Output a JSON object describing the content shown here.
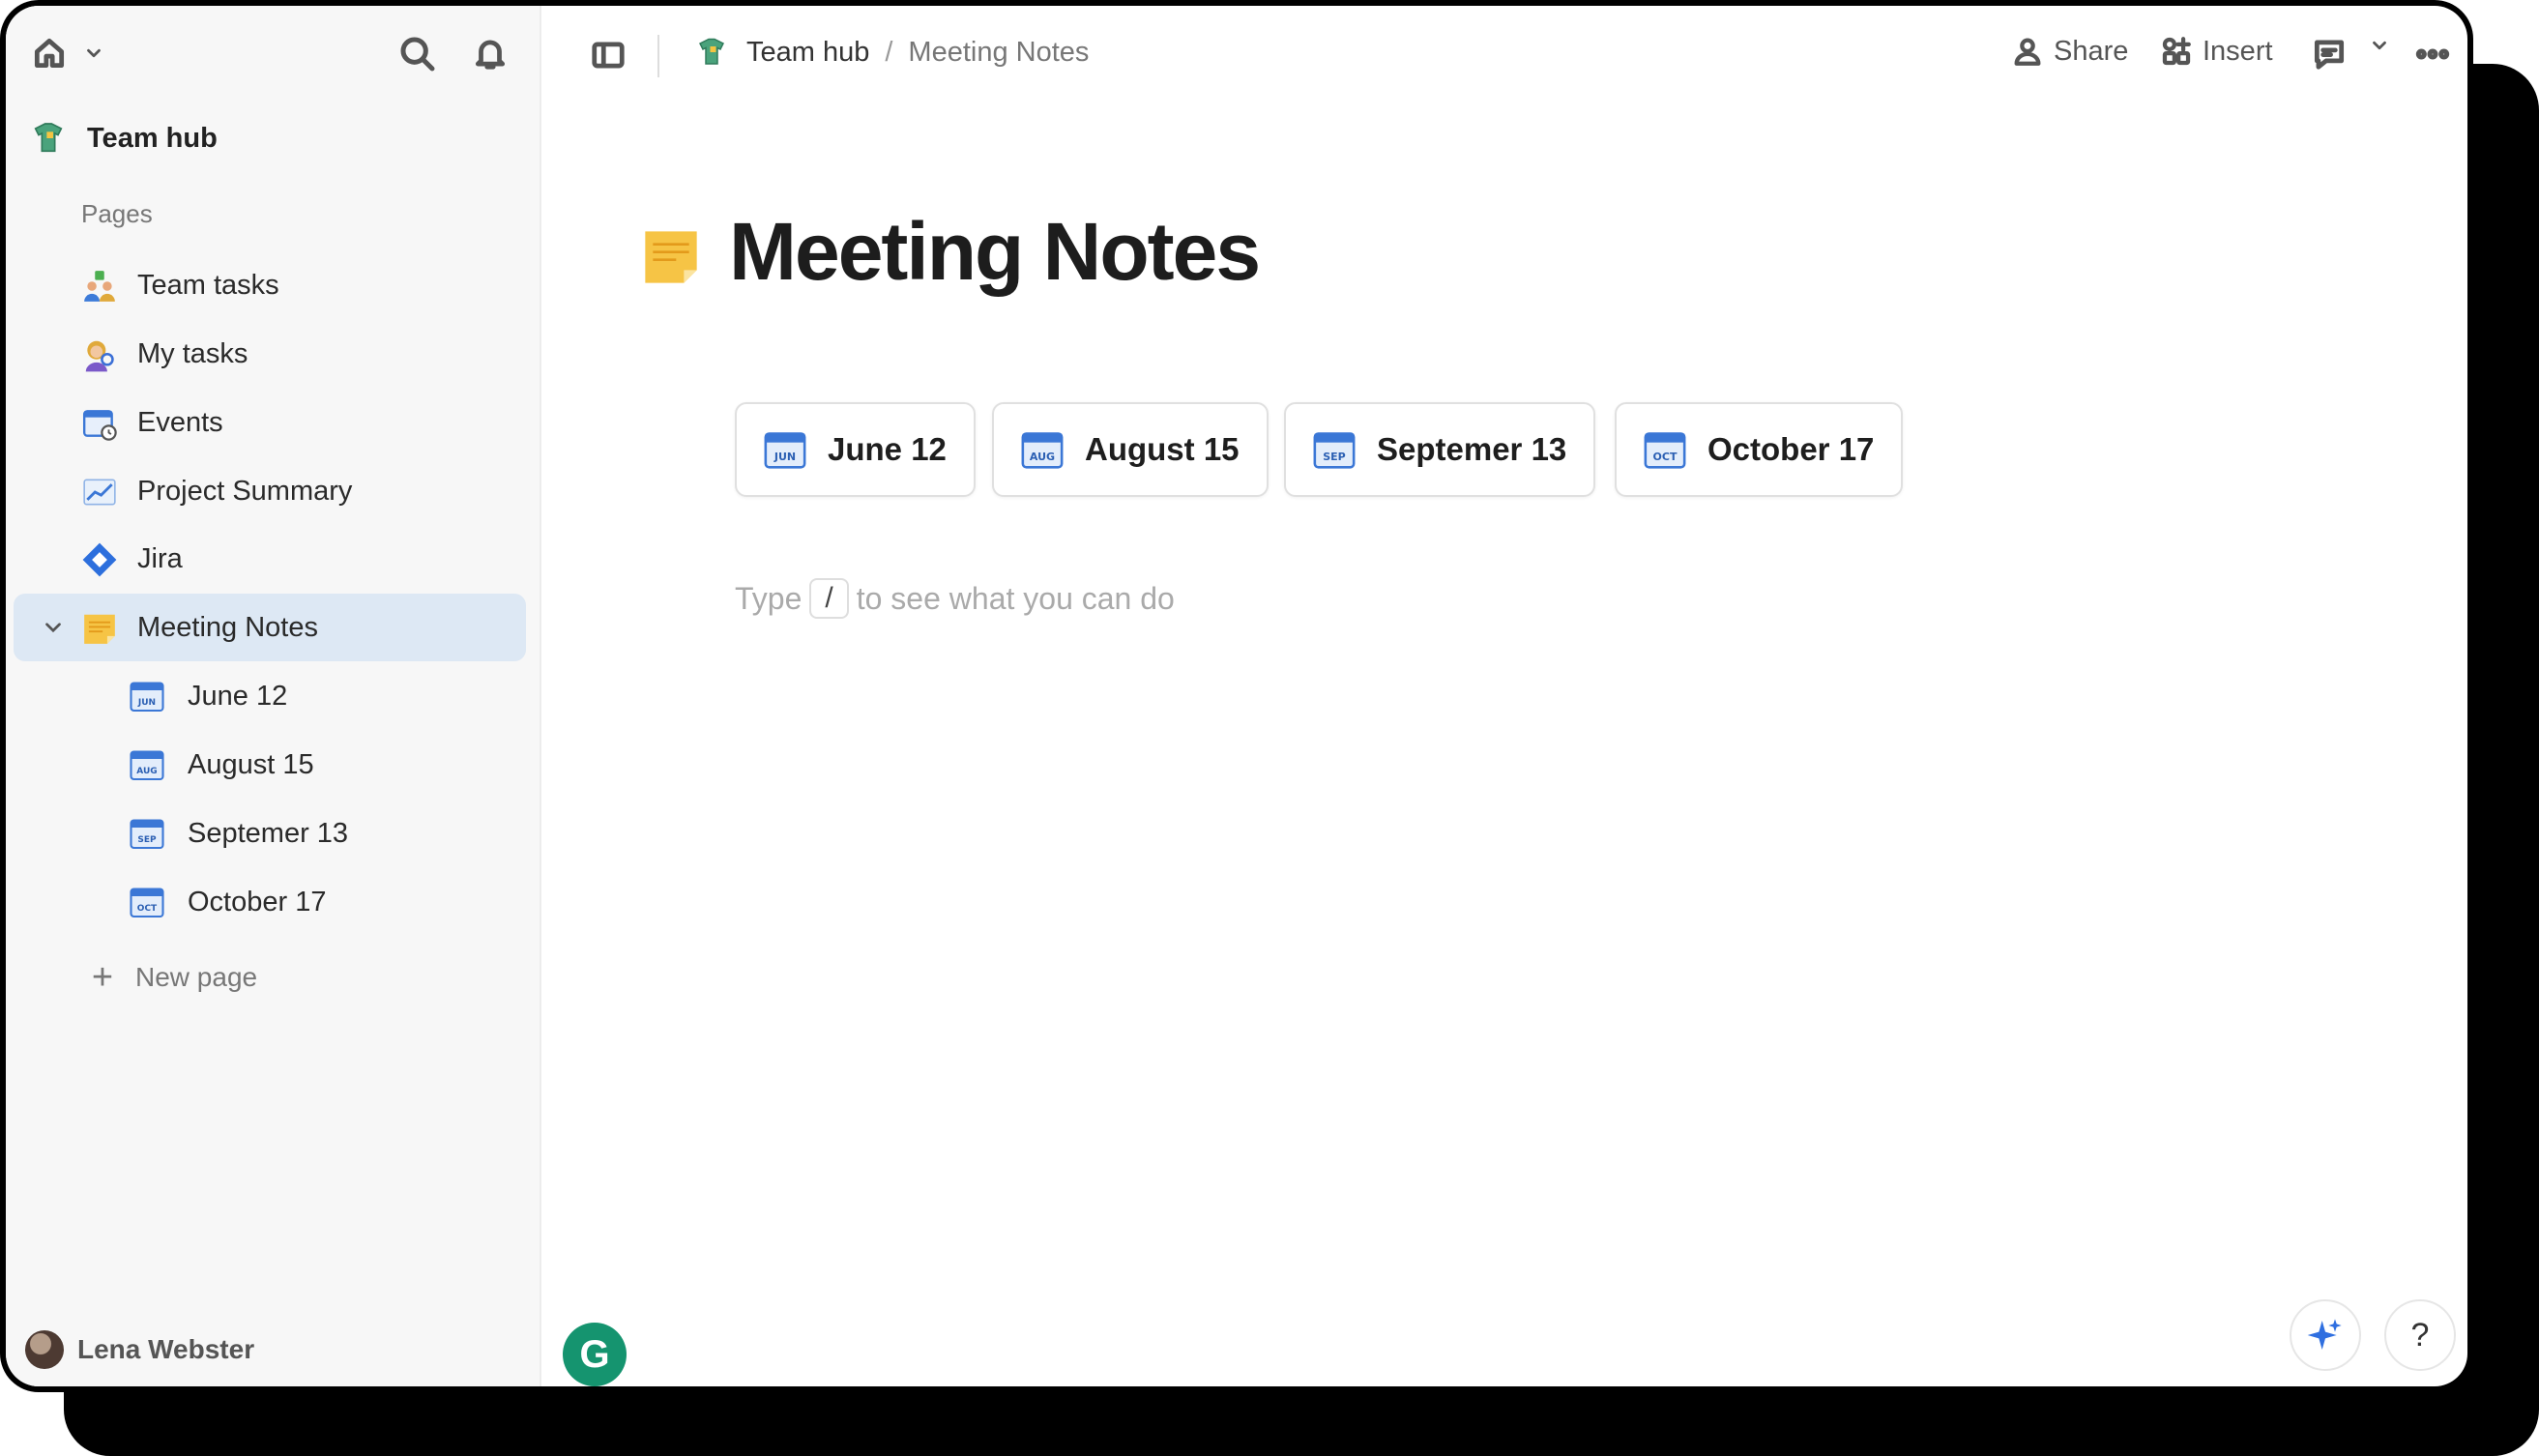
{
  "sidebar": {
    "workspace_name": "Team hub",
    "section_label": "Pages",
    "items": [
      {
        "label": "Team tasks"
      },
      {
        "label": "My tasks"
      },
      {
        "label": "Events"
      },
      {
        "label": "Project Summary"
      },
      {
        "label": "Jira"
      },
      {
        "label": "Meeting Notes"
      }
    ],
    "subitems": [
      {
        "label": "June 12",
        "month": "JUN"
      },
      {
        "label": "August 15",
        "month": "AUG"
      },
      {
        "label": "Septemer 13",
        "month": "SEP"
      },
      {
        "label": "October 17",
        "month": "OCT"
      }
    ],
    "new_page_label": "New page",
    "user_name": "Lena Webster"
  },
  "topbar": {
    "breadcrumb": [
      "Team hub",
      "Meeting Notes"
    ],
    "breadcrumb_sep": "/",
    "share_label": "Share",
    "insert_label": "Insert"
  },
  "main": {
    "title": "Meeting Notes",
    "chips": [
      {
        "label": "June 12",
        "month": "JUN"
      },
      {
        "label": "August 15",
        "month": "AUG"
      },
      {
        "label": "Septemer 13",
        "month": "SEP"
      },
      {
        "label": "October 17",
        "month": "OCT"
      }
    ],
    "hint_before": "Type",
    "hint_key": "/",
    "hint_after": "to see what you can do"
  },
  "floating": {
    "grammarly_letter": "G",
    "help_label": "?"
  },
  "colors": {
    "active_item_bg": "#dde8f4",
    "accent_blue": "#2f6fe0",
    "sticky_note_yellow": "#f6c445",
    "grammarly_green": "#15946f"
  }
}
